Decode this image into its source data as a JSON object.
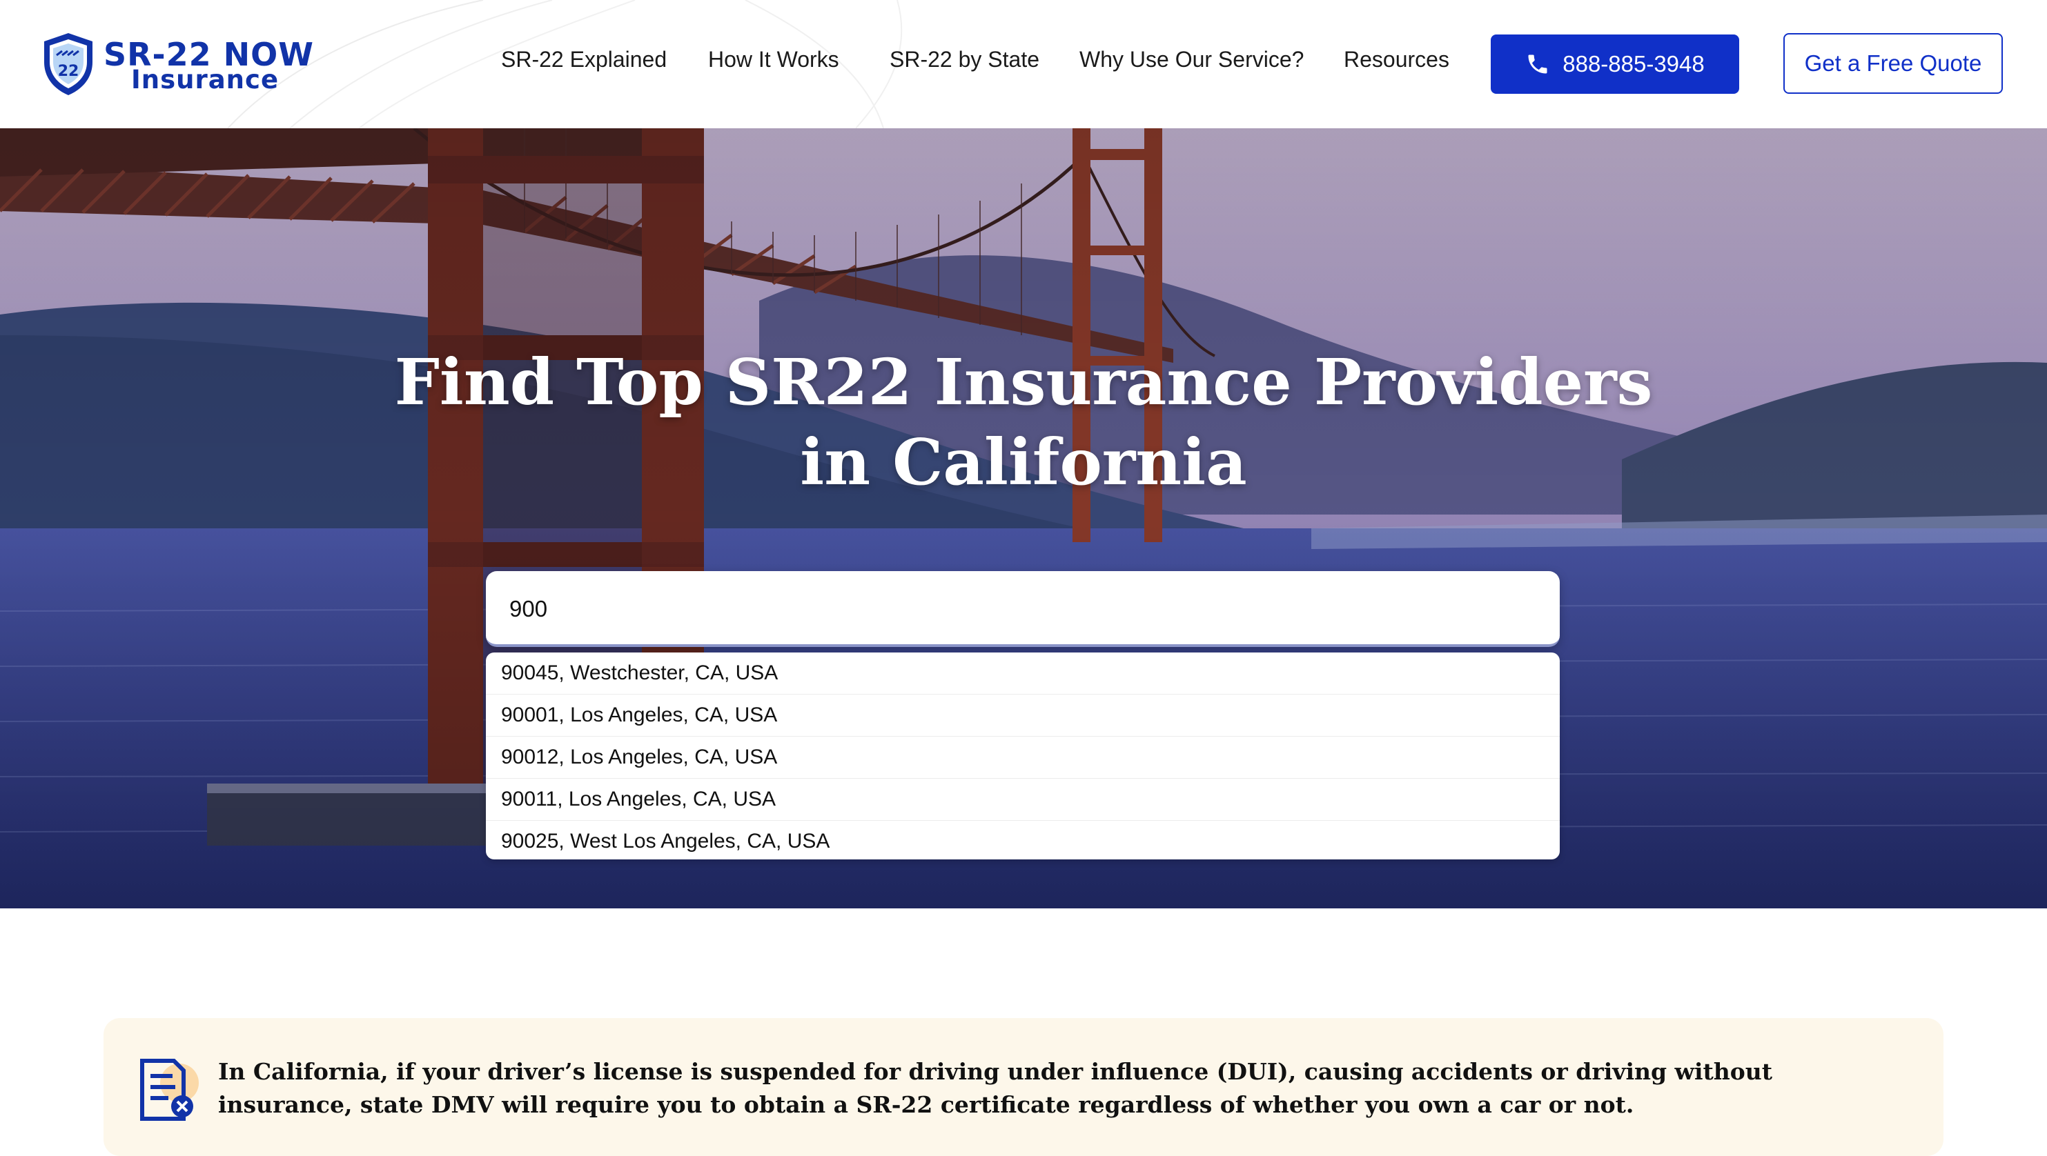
{
  "header": {
    "logo": {
      "line1": "SR-22 NOW",
      "line2": "Insurance",
      "badge_text": "22"
    },
    "nav": [
      {
        "label": "SR-22 Explained"
      },
      {
        "label": "How It Works"
      },
      {
        "label": "SR-22 by State"
      },
      {
        "label": "Why Use Our Service?"
      },
      {
        "label": "Resources"
      }
    ],
    "phone": {
      "label": "888-885-3948",
      "icon": "phone-icon"
    },
    "quote_button": "Get a Free Quote"
  },
  "hero": {
    "title_line1": "Find Top SR22 Insurance Providers",
    "title_line2": "in California",
    "search": {
      "value": "900",
      "placeholder": ""
    },
    "suggestions": [
      "90045, Westchester, CA, USA",
      "90001, Los Angeles, CA, USA",
      "90012, Los Angeles, CA, USA",
      "90011, Los Angeles, CA, USA",
      "90025, West Los Angeles, CA, USA"
    ]
  },
  "info_card": {
    "icon": "document-icon",
    "text": "In California, if your driver’s license is suspended for driving under influence (DUI), causing accidents or driving without insurance, state DMV will require you to obtain a SR-22 certificate regardless of whether you own a car or not."
  },
  "colors": {
    "brand_blue": "#1030c8",
    "logo_blue": "#1133a8",
    "card_bg": "#fdf7ea"
  }
}
